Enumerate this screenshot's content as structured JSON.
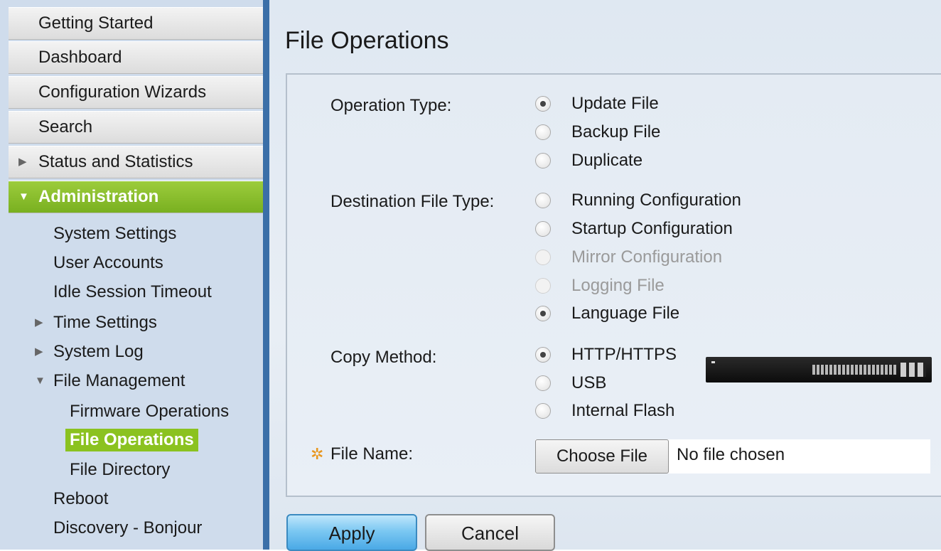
{
  "sidebar": {
    "top_items": [
      {
        "label": "Getting Started"
      },
      {
        "label": "Dashboard"
      },
      {
        "label": "Configuration Wizards"
      },
      {
        "label": "Search"
      },
      {
        "label": "Status and Statistics",
        "expander": "▶"
      },
      {
        "label": "Administration",
        "expander": "▼",
        "active": true
      }
    ],
    "admin_items": [
      {
        "label": "System Settings"
      },
      {
        "label": "User Accounts"
      },
      {
        "label": "Idle Session Timeout"
      },
      {
        "label": "Time Settings",
        "expander": "▶"
      },
      {
        "label": "System Log",
        "expander": "▶"
      },
      {
        "label": "File Management",
        "expander": "▼"
      },
      {
        "label": "Firmware Operations"
      },
      {
        "label": "File Operations",
        "selected": true
      },
      {
        "label": "File Directory"
      },
      {
        "label": "Reboot"
      },
      {
        "label": "Discovery - Bonjour"
      }
    ]
  },
  "page": {
    "title": "File Operations"
  },
  "form": {
    "operation_type": {
      "label": "Operation Type:",
      "options": [
        "Update File",
        "Backup File",
        "Duplicate"
      ],
      "selected": "Update File"
    },
    "destination_file_type": {
      "label": "Destination File Type:",
      "options": [
        "Running Configuration",
        "Startup Configuration",
        "Mirror Configuration",
        "Logging File",
        "Language File"
      ],
      "disabled": [
        "Mirror Configuration",
        "Logging File"
      ],
      "selected": "Language File"
    },
    "copy_method": {
      "label": "Copy Method:",
      "options": [
        "HTTP/HTTPS",
        "USB",
        "Internal Flash"
      ],
      "selected": "HTTP/HTTPS"
    },
    "file_name": {
      "required_icon": "✲",
      "label": "File Name:",
      "choose_button": "Choose File",
      "status": "No file chosen"
    }
  },
  "buttons": {
    "apply": "Apply",
    "cancel": "Cancel"
  },
  "colors": {
    "active_nav": "#8bc220",
    "sidebar_divider": "#3b6fa8",
    "apply_button": "#7cc8f2",
    "required_star": "#e8961e"
  }
}
